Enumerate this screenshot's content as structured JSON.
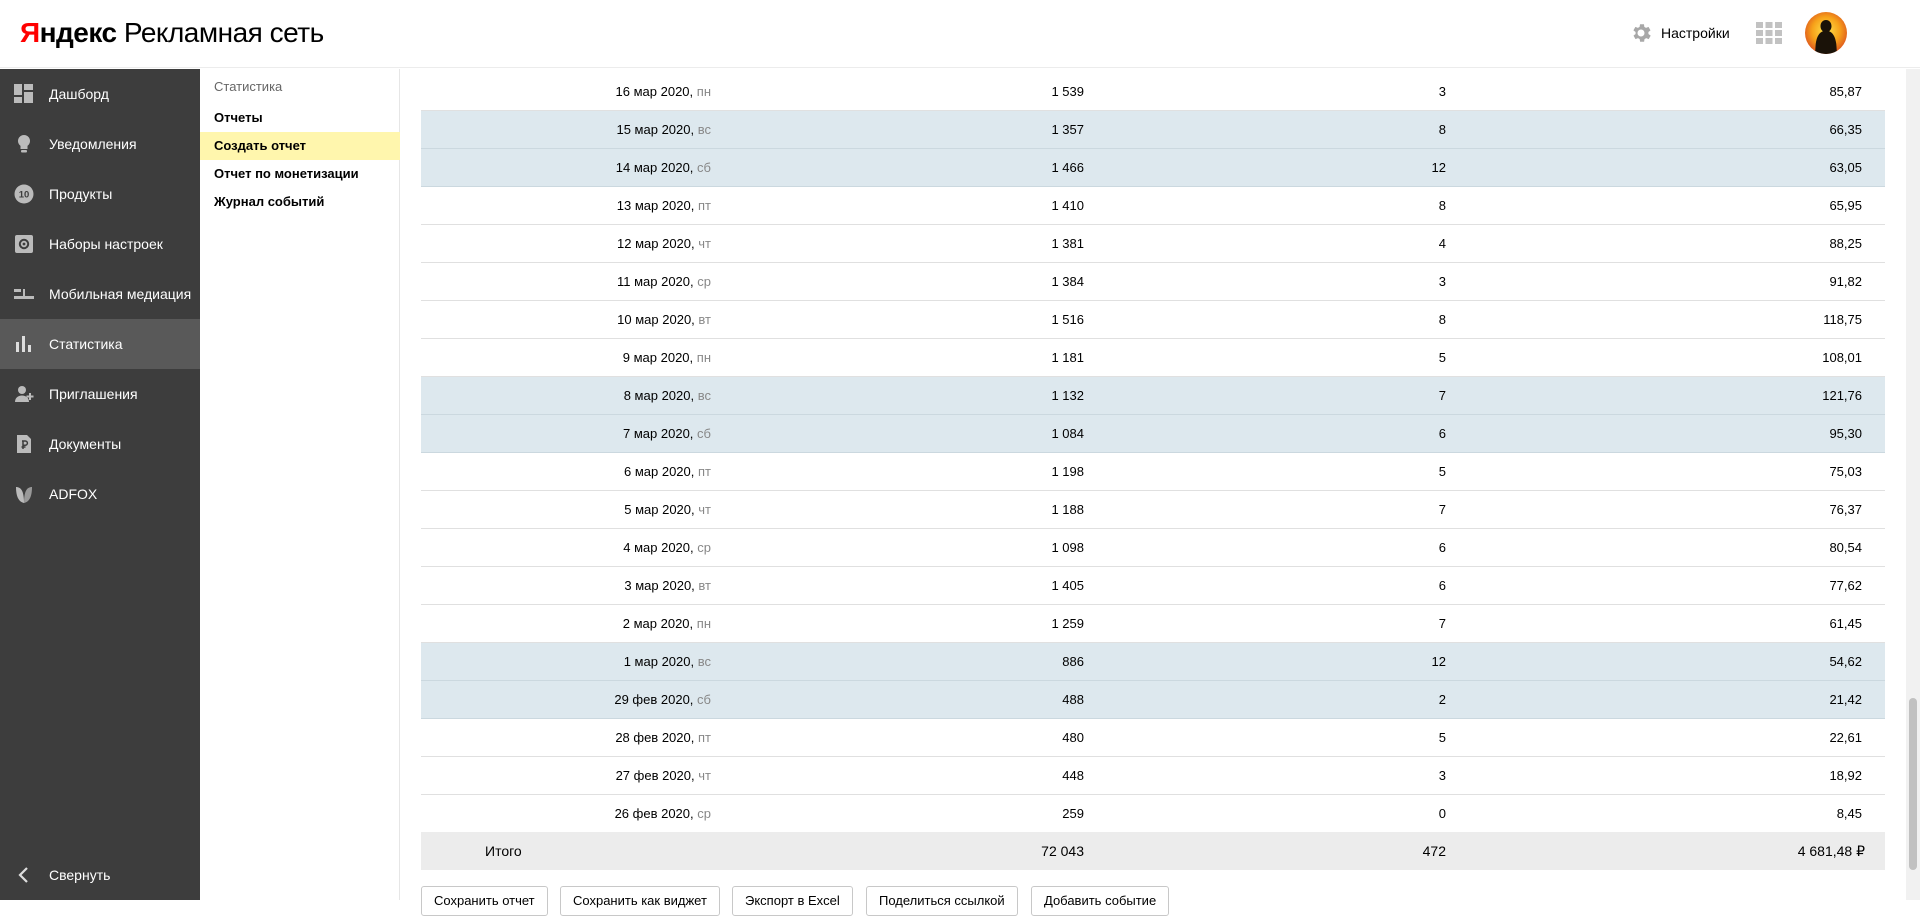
{
  "header": {
    "logo_ya": "Я",
    "logo_ya_rest": "ндекс",
    "logo_rest": "Рекламная сеть",
    "settings_label": "Настройки"
  },
  "sidebar": {
    "items": [
      {
        "label": "Дашборд",
        "icon": "dashboard-icon"
      },
      {
        "label": "Уведомления",
        "icon": "bulb-icon"
      },
      {
        "label": "Продукты",
        "icon": "products-icon",
        "badge": "10"
      },
      {
        "label": "Наборы настроек",
        "icon": "settings-set-icon"
      },
      {
        "label": "Мобильная медиация",
        "icon": "mediation-icon"
      },
      {
        "label": "Статистика",
        "icon": "stats-icon",
        "active": true
      },
      {
        "label": "Приглашения",
        "icon": "invite-icon"
      },
      {
        "label": "Документы",
        "icon": "document-icon"
      },
      {
        "label": "ADFOX",
        "icon": "adfox-icon"
      }
    ],
    "collapse_label": "Свернуть"
  },
  "subnav": {
    "title": "Статистика",
    "items": [
      {
        "label": "Отчеты"
      },
      {
        "label": "Создать отчет",
        "active": true
      },
      {
        "label": "Отчет по монетизации"
      },
      {
        "label": "Журнал событий"
      }
    ]
  },
  "table": {
    "rows": [
      {
        "date": "16 мар 2020,",
        "dow": "пн",
        "shows": "1 539",
        "clicks": "3",
        "revenue": "85,87",
        "weekend": false
      },
      {
        "date": "15 мар 2020,",
        "dow": "вс",
        "shows": "1 357",
        "clicks": "8",
        "revenue": "66,35",
        "weekend": true
      },
      {
        "date": "14 мар 2020,",
        "dow": "сб",
        "shows": "1 466",
        "clicks": "12",
        "revenue": "63,05",
        "weekend": true
      },
      {
        "date": "13 мар 2020,",
        "dow": "пт",
        "shows": "1 410",
        "clicks": "8",
        "revenue": "65,95",
        "weekend": false
      },
      {
        "date": "12 мар 2020,",
        "dow": "чт",
        "shows": "1 381",
        "clicks": "4",
        "revenue": "88,25",
        "weekend": false
      },
      {
        "date": "11 мар 2020,",
        "dow": "ср",
        "shows": "1 384",
        "clicks": "3",
        "revenue": "91,82",
        "weekend": false
      },
      {
        "date": "10 мар 2020,",
        "dow": "вт",
        "shows": "1 516",
        "clicks": "8",
        "revenue": "118,75",
        "weekend": false
      },
      {
        "date": "9 мар 2020,",
        "dow": "пн",
        "shows": "1 181",
        "clicks": "5",
        "revenue": "108,01",
        "weekend": false
      },
      {
        "date": "8 мар 2020,",
        "dow": "вс",
        "shows": "1 132",
        "clicks": "7",
        "revenue": "121,76",
        "weekend": true
      },
      {
        "date": "7 мар 2020,",
        "dow": "сб",
        "shows": "1 084",
        "clicks": "6",
        "revenue": "95,30",
        "weekend": true
      },
      {
        "date": "6 мар 2020,",
        "dow": "пт",
        "shows": "1 198",
        "clicks": "5",
        "revenue": "75,03",
        "weekend": false
      },
      {
        "date": "5 мар 2020,",
        "dow": "чт",
        "shows": "1 188",
        "clicks": "7",
        "revenue": "76,37",
        "weekend": false
      },
      {
        "date": "4 мар 2020,",
        "dow": "ср",
        "shows": "1 098",
        "clicks": "6",
        "revenue": "80,54",
        "weekend": false
      },
      {
        "date": "3 мар 2020,",
        "dow": "вт",
        "shows": "1 405",
        "clicks": "6",
        "revenue": "77,62",
        "weekend": false
      },
      {
        "date": "2 мар 2020,",
        "dow": "пн",
        "shows": "1 259",
        "clicks": "7",
        "revenue": "61,45",
        "weekend": false
      },
      {
        "date": "1 мар 2020,",
        "dow": "вс",
        "shows": "886",
        "clicks": "12",
        "revenue": "54,62",
        "weekend": true
      },
      {
        "date": "29 фев 2020,",
        "dow": "сб",
        "shows": "488",
        "clicks": "2",
        "revenue": "21,42",
        "weekend": true
      },
      {
        "date": "28 фев 2020,",
        "dow": "пт",
        "shows": "480",
        "clicks": "5",
        "revenue": "22,61",
        "weekend": false
      },
      {
        "date": "27 фев 2020,",
        "dow": "чт",
        "shows": "448",
        "clicks": "3",
        "revenue": "18,92",
        "weekend": false
      },
      {
        "date": "26 фев 2020,",
        "dow": "ср",
        "shows": "259",
        "clicks": "0",
        "revenue": "8,45",
        "weekend": false
      }
    ],
    "total": {
      "label": "Итого",
      "shows": "72 043",
      "clicks": "472",
      "revenue": "4 681,48 ₽"
    }
  },
  "actions": [
    {
      "label": "Сохранить отчет"
    },
    {
      "label": "Сохранить как виджет"
    },
    {
      "label": "Экспорт в Excel"
    },
    {
      "label": "Поделиться ссылкой"
    },
    {
      "label": "Добавить событие"
    }
  ],
  "colors": {
    "sidebar_bg": "#3d3d3d",
    "sidebar_active": "#595959",
    "subnav_active": "#fff6ad",
    "weekend_row": "#dde8ee",
    "total_row": "#ececec",
    "logo_red": "#ff0000"
  }
}
